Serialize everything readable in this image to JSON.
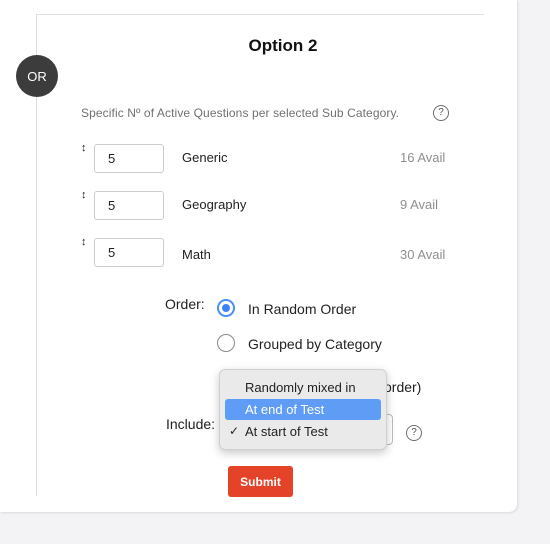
{
  "section": {
    "or_label": "OR",
    "title": "Option 2",
    "description": "Specific Nº of Active Questions per selected Sub Category.",
    "help_icon": "?"
  },
  "categories": [
    {
      "value": "5",
      "name": "Generic",
      "avail": "16 Avail"
    },
    {
      "value": "5",
      "name": "Geography",
      "avail": "9 Avail"
    },
    {
      "value": "5",
      "name": "Math",
      "avail": "30 Avail"
    }
  ],
  "order": {
    "label": "Order:",
    "options": [
      {
        "label": "In Random Order",
        "checked": true
      },
      {
        "label": "Grouped by Category",
        "checked": false
      }
    ],
    "partially_hidden_text": "order)"
  },
  "include": {
    "label": "Include:",
    "selected": "At start of Test",
    "options": [
      {
        "label": "Randomly mixed in"
      },
      {
        "label": "At end of Test",
        "highlighted": true
      },
      {
        "label": "At start of Test",
        "selected": true
      }
    ]
  },
  "submit_label": "Submit",
  "colors": {
    "accent": "#3b82f6",
    "submit": "#e4432a",
    "badge": "#3c3c3c"
  }
}
